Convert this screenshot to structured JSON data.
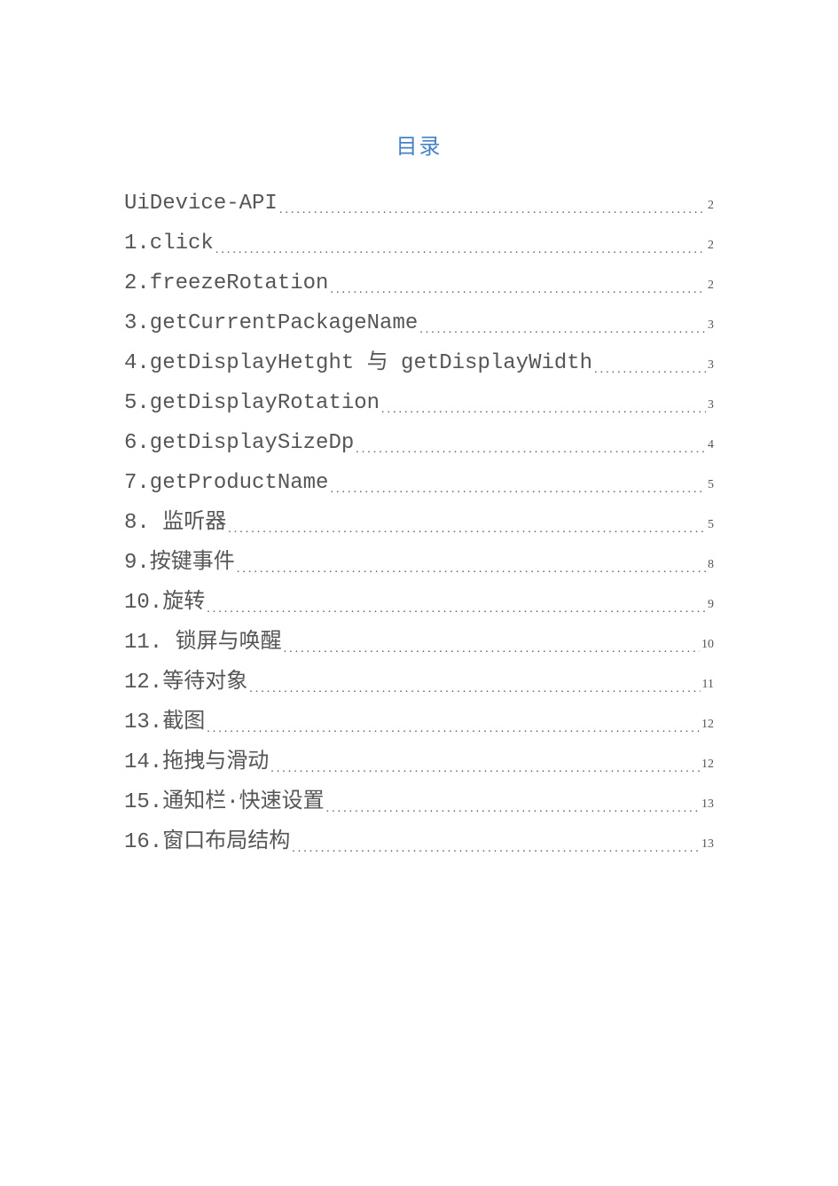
{
  "title": "目录",
  "leader_fill": "........................................................................................................................",
  "entries": [
    {
      "label": "UiDevice-API",
      "page": "2"
    },
    {
      "label": "1.click",
      "page": "2"
    },
    {
      "label": "2.freezeRotation",
      "page": "2"
    },
    {
      "label": "3.getCurrentPackageName",
      "page": "3"
    },
    {
      "label": "4.getDisplayHetght 与 getDisplayWidth",
      "page": "3"
    },
    {
      "label": "5.getDisplayRotation",
      "page": "3"
    },
    {
      "label": "6.getDisplaySizeDp",
      "page": "4"
    },
    {
      "label": "7.getProductName",
      "page": "5"
    },
    {
      "label": "8. 监听器",
      "page": "5"
    },
    {
      "label": "9.按键事件",
      "page": "8"
    },
    {
      "label": "10.旋转",
      "page": "9"
    },
    {
      "label": "11. 锁屏与唤醒",
      "page": "10"
    },
    {
      "label": "12.等待对象",
      "page": "11"
    },
    {
      "label": "13.截图",
      "page": "12"
    },
    {
      "label": "14.拖拽与滑动",
      "page": "12"
    },
    {
      "label": "15.通知栏·快速设置",
      "page": "13"
    },
    {
      "label": "16.窗口布局结构",
      "page": "13"
    }
  ]
}
